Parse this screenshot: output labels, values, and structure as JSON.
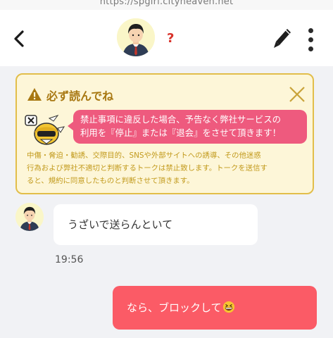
{
  "browser": {
    "url": "https://spgirl.cityheaven.net"
  },
  "header": {
    "partner_name": "?",
    "icons": {
      "back": "chevron-left-icon",
      "edit": "pen-icon",
      "more": "more-vertical-icon"
    }
  },
  "notice": {
    "title": "必ず読んでね",
    "bubble_line1": "禁止事項に違反した場合、予告なく弊社サービスの",
    "bubble_line2": "利用を『停止』または『退会』をさせて頂きます！",
    "body_line1": "中傷・脅迫・勧誘、交際目的、SNSや外部サイトへの誘導、その他迷惑",
    "body_line2": "行為および弊社不適切と判断するトークは禁止致します。トークを送信す",
    "body_line3": "ると、規約に同意したものと判断させて頂きます。",
    "colors": {
      "border": "#e2be4a",
      "background": "#fdf6d8",
      "bubble": "#ee5a7e",
      "text": "#c29a1c"
    }
  },
  "messages": [
    {
      "direction": "received",
      "text": "うざいで送らんといて",
      "time": "19:56"
    },
    {
      "direction": "sent",
      "text": "なら、ブロックして",
      "emoji": "grinning-squinting-face"
    }
  ]
}
